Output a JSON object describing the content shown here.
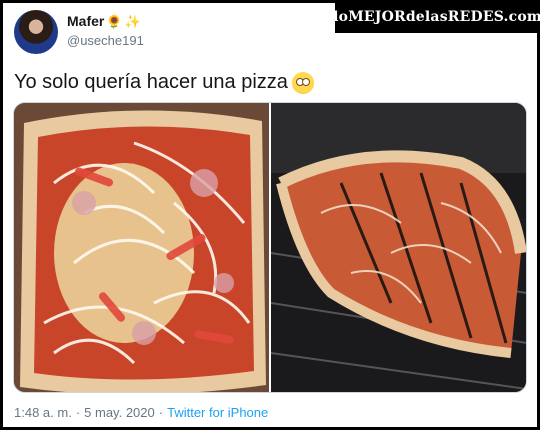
{
  "author": {
    "display_name": "Mafer",
    "emoji_1": "🌻",
    "emoji_2": "✨",
    "handle": "@useche191"
  },
  "watermark": {
    "text": "loMEJORdelasREDES.com"
  },
  "tweet": {
    "text": "Yo solo quería hacer una pizza",
    "emoji_icon": "pleading-face-icon"
  },
  "media": [
    {
      "description_icon": "pizza-photo"
    },
    {
      "description_icon": "pizza-in-oven-photo"
    }
  ],
  "meta": {
    "time": "1:48 a. m.",
    "separator": "·",
    "date": "5 may. 2020",
    "source_separator": "·",
    "source": "Twitter for iPhone"
  },
  "colors": {
    "link": "#1da1f2",
    "secondary_text": "#657786",
    "primary_text": "#14171a"
  }
}
